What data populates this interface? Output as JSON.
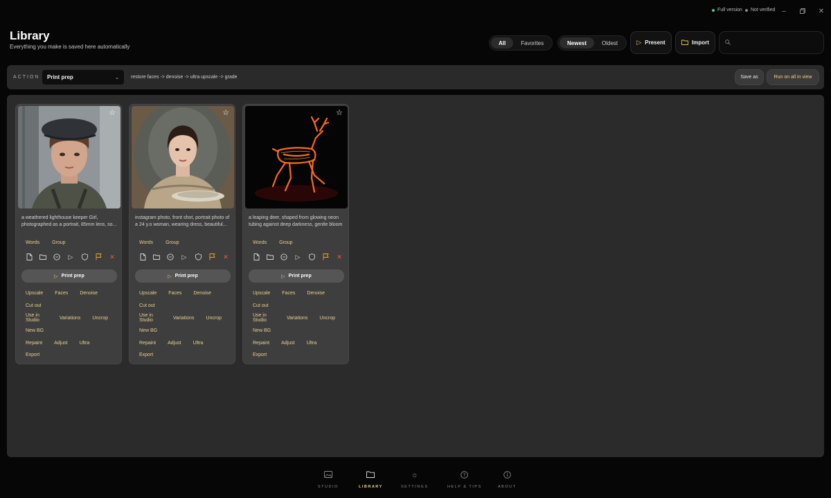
{
  "window": {
    "status_full": "Full version",
    "status_full_color": "#4ecb8a",
    "status_verified": "Not verified",
    "status_verified_color": "#8a8a8a"
  },
  "header": {
    "title": "Library",
    "subtitle": "Everything you make is saved here automatically",
    "filter_options": [
      "All",
      "Favorites"
    ],
    "filter_selected": "All",
    "sort_options": [
      "Newest",
      "Oldest"
    ],
    "sort_selected": "Newest",
    "present_label": "Present",
    "import_label": "Import",
    "search_placeholder": ""
  },
  "actionbar": {
    "label": "ACTION",
    "selected_action": "Print prep",
    "pipeline": "restore faces -> denoise -> ultra upscale -> grade",
    "save_as_label": "Save as",
    "run_all_label": "Run on all in view"
  },
  "card_labels": {
    "words": "Words",
    "group": "Group",
    "run_action": "Print prep",
    "ops": [
      [
        "Upscale",
        "Faces",
        "Denoise"
      ],
      [
        "Cut out"
      ],
      [
        "Use in Studio",
        "Variations",
        "Uncrop"
      ],
      [
        "New BG"
      ],
      [
        "Repaint",
        "Adjust",
        "Ultra"
      ],
      [
        "Export"
      ]
    ]
  },
  "cards": [
    {
      "caption": "a weathered lighthouse keeper Girl, photographed as a portrait, 85mm lens, so..."
    },
    {
      "caption": "instagram photo, front shot, portrait photo of a 24 y.o woman, wearing dress, beautiful..."
    },
    {
      "caption": "a leaping deer, shaped from glowing neon tubing against deep darkness, gentle bloom"
    }
  ],
  "nav": [
    {
      "label": "STUDIO",
      "icon": "image-icon"
    },
    {
      "label": "LIBRARY",
      "icon": "folder-icon",
      "active": true
    },
    {
      "label": "SETTINGS",
      "icon": "gear-icon"
    },
    {
      "label": "HELP & TIPS",
      "icon": "help-icon"
    },
    {
      "label": "ABOUT",
      "icon": "info-icon"
    }
  ],
  "colors": {
    "accent": "#e9c46a",
    "delete": "#e85a4a",
    "flag": "#e9a53b",
    "neon": "#ff6a1a"
  }
}
